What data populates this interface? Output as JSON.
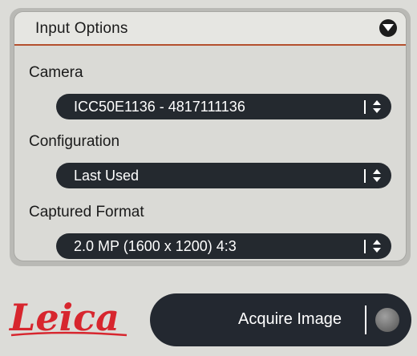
{
  "panel": {
    "title": "Input Options",
    "collapse_icon": "chevron-down-circle-icon"
  },
  "fields": {
    "camera": {
      "label": "Camera",
      "value": "ICC50E1136 - 4817111136"
    },
    "configuration": {
      "label": "Configuration",
      "value": "Last Used"
    },
    "captured_format": {
      "label": "Captured Format",
      "value": "2.0 MP (1600 x 1200) 4:3"
    }
  },
  "brand": {
    "logo_text": "Leica",
    "color": "#d7262e"
  },
  "acquire": {
    "label": "Acquire Image"
  },
  "colors": {
    "accent_line": "#b4502e",
    "control_bg": "#24292f"
  }
}
